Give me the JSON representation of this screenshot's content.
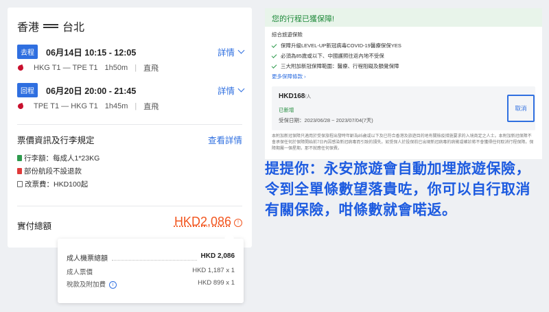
{
  "flight": {
    "route": {
      "from": "香港",
      "to": "台北"
    },
    "segments": [
      {
        "badge": "去程",
        "datetime": "06月14日  10:15 - 12:05",
        "details_label": "詳情",
        "route": "HKG T1 — TPE T1",
        "duration": "1h50m",
        "type": "直飛"
      },
      {
        "badge": "回程",
        "datetime": "06月20日  20:00 - 21:45",
        "details_label": "詳情",
        "route": "TPE T1 — HKG T1",
        "duration": "1h45m",
        "type": "直飛"
      }
    ],
    "rules": {
      "title": "票價資訊及行李規定",
      "link": "查看詳情",
      "items": [
        "行李額：每成人1*23KG",
        "部份航段不設退款",
        "改票費：HKD100起"
      ]
    },
    "total": {
      "label": "實付總額",
      "value": "HKD2,086"
    }
  },
  "breakdown": {
    "rows": [
      {
        "label": "成人機票總額",
        "value": "HKD 2,086"
      },
      {
        "label": "成人票價",
        "value": "HKD 1,187 x 1"
      },
      {
        "label": "稅款及附加費",
        "value": "HKD 899 x 1"
      }
    ]
  },
  "insurance": {
    "header": "您的行程已獲保障!",
    "plan": "綜合旅遊保險",
    "checks": [
      "保障升級LEVEL-UP新冠病毒COVID-19醫療保保YES",
      "必須為85歲或以下、中國護照往返內地不受保",
      "三大附加新冠保障範圍：醫療、行程阻礙及額覺保障"
    ],
    "more_link": "更多保障條款 ›",
    "price": "HKD168",
    "price_unit": "/人",
    "status": "已新增",
    "dates": "受保日期：2023/06/28 ~ 2023/07/04(7天)",
    "cancel": "取消",
    "fine_print": "本附加新冠保障只適用於受保旅程出發時年齡為85歲或以下及已符合香港及旅遊目的地有關檢疫措施要求的入境商定之人士。本附加新冠保障不會承保任何於保障開始前7日內因感染新冠病毒而引致的損失。如受保人於投保前已出現新冠病毒的病徵或確診將不會獲得任何取消行程保障。保障期屬一個星期，那不就應任何保費。"
  },
  "annotation": "提提你：永安旅遊會自動加埋旅遊保險，令到全單條數望落貴咗，你可以自行取消有關保險，咁條數就會喏返。",
  "colors": {
    "accent": "#2f6fe0",
    "price": "#f2551e",
    "success": "#1f8a3b"
  }
}
